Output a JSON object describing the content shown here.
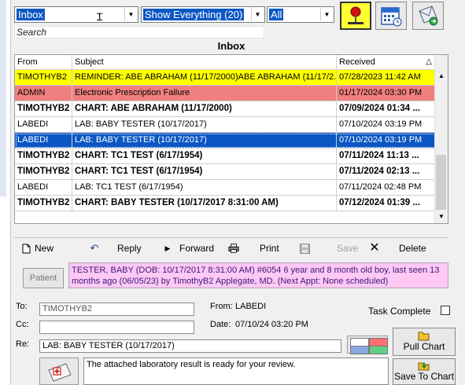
{
  "toolbar": {
    "folder_value": "Inbox",
    "filter_value": "Show Everything (20)",
    "scope_value": "All",
    "search_placeholder": "Search"
  },
  "inbox_title": "Inbox",
  "columns": {
    "from": "From",
    "subject": "Subject",
    "received": "Received"
  },
  "rows": [
    {
      "from": "TIMOTHYB2",
      "subject": "REMINDER: ABE ABRAHAM  (11/17/2000)ABE ABRAHAM  (11/17/2...",
      "received": "07/28/2023 11:42 AM"
    },
    {
      "from": "ADMIN",
      "subject": "Electronic Prescription Failure",
      "received": "01/17/2024 03:30 PM"
    },
    {
      "from": "TIMOTHYB2",
      "subject": "CHART: ABE ABRAHAM  (11/17/2000)",
      "received": "07/09/2024 01:34 ..."
    },
    {
      "from": "LABEDI",
      "subject": "LAB: BABY TESTER (10/17/2017)",
      "received": "07/10/2024 03:19 PM"
    },
    {
      "from": "LABEDI",
      "subject": "LAB: BABY TESTER (10/17/2017)",
      "received": "07/10/2024 03:19 PM"
    },
    {
      "from": "TIMOTHYB2",
      "subject": "CHART: TC1 TEST  (6/17/1954)",
      "received": "07/11/2024 11:13 ..."
    },
    {
      "from": "TIMOTHYB2",
      "subject": "CHART: TC1 TEST  (6/17/1954)",
      "received": "07/11/2024 02:13 ..."
    },
    {
      "from": "LABEDI",
      "subject": "LAB: TC1 TEST (6/17/1954)",
      "received": "07/11/2024 02:48 PM"
    },
    {
      "from": "TIMOTHYB2",
      "subject": "CHART: BABY TESTER  (10/17/2017 8:31:00 AM)",
      "received": "07/12/2024 01:39 ..."
    }
  ],
  "actions": {
    "new": "New",
    "reply": "Reply",
    "forward": "Forward",
    "print": "Print",
    "save": "Save",
    "delete": "Delete"
  },
  "patient": {
    "button": "Patient",
    "info": "TESTER, BABY (DOB: 10/17/2017 8:31:00 AM) #6054  6 year and 8 month old boy, last seen 13 months ago (06/05/23) by TimothyB2 Applegate, MD. (Next Appt: None scheduled)"
  },
  "message": {
    "to_label": "To:",
    "to_value": "TIMOTHYB2",
    "cc_label": "Cc:",
    "cc_value": "",
    "from_label": "From:",
    "from_value": "LABEDI",
    "date_label": "Date:",
    "date_value": "07/10/24 03:20 PM",
    "task_complete_label": "Task Complete",
    "re_label": "Re:",
    "re_value": "LAB: BABY TESTER (10/17/2017)",
    "body": "The attached laboratory result is ready for your review.",
    "pull_chart": "Pull Chart",
    "save_to_chart": "Save To Chart"
  },
  "colors": {
    "selection": "#0a57c4",
    "reminder_row": "#ffff00",
    "alert_row": "#f08080",
    "patient_banner": "#ffc8f5"
  }
}
